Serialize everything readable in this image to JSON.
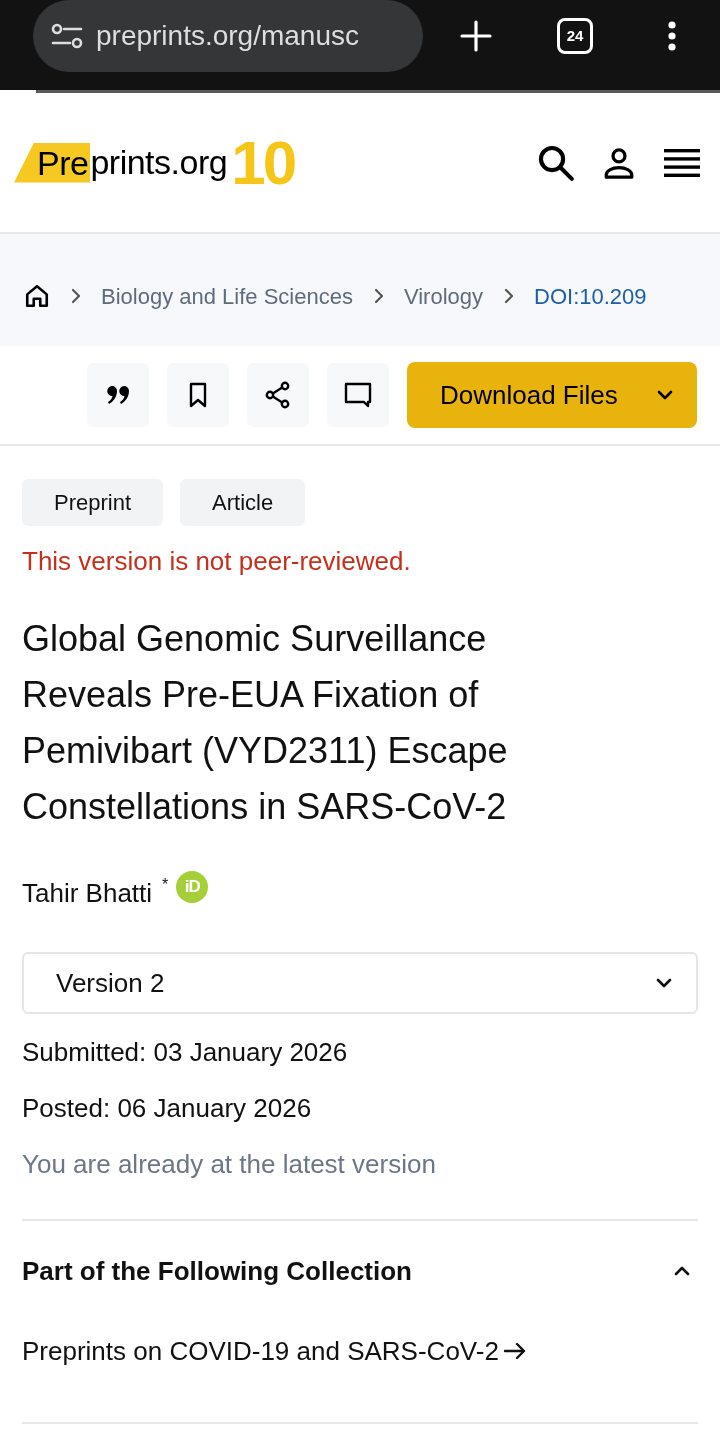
{
  "browser": {
    "url": "preprints.org/manusc",
    "tab_count": "24"
  },
  "logo": {
    "highlight": "Pre",
    "text": "prints.org",
    "badge": "10"
  },
  "breadcrumb": [
    {
      "label": "Biology and Life Sciences",
      "kind": "category"
    },
    {
      "label": "Virology",
      "kind": "category"
    },
    {
      "label": "DOI:10.209",
      "kind": "current"
    }
  ],
  "actions": [
    {
      "kind": "cite"
    },
    {
      "kind": "bookmark"
    },
    {
      "kind": "share"
    },
    {
      "kind": "comment"
    }
  ],
  "download": {
    "label": "Download Files"
  },
  "tags": [
    {
      "label": "Preprint"
    },
    {
      "label": "Article"
    }
  ],
  "notice": "This version is not peer-reviewed.",
  "title": "Global Genomic Surveillance Reveals Pre-EUA Fixation of Pemivibart (VYD2311) Escape Constellations in SARS-CoV-2",
  "authors": [
    {
      "name": "Tahir Bhatti",
      "mark": "*",
      "orcid": "iD"
    }
  ],
  "version_select": {
    "value": "Version 2"
  },
  "dates": [
    "Submitted: 03 January 2026",
    "Posted: 06 January 2026"
  ],
  "version_note": "You are already at the latest version",
  "collection": {
    "heading": "Part of the Following Collection",
    "expanded": true,
    "links": [
      "Preprints on COVID-19 and SARS-CoV-2"
    ]
  }
}
